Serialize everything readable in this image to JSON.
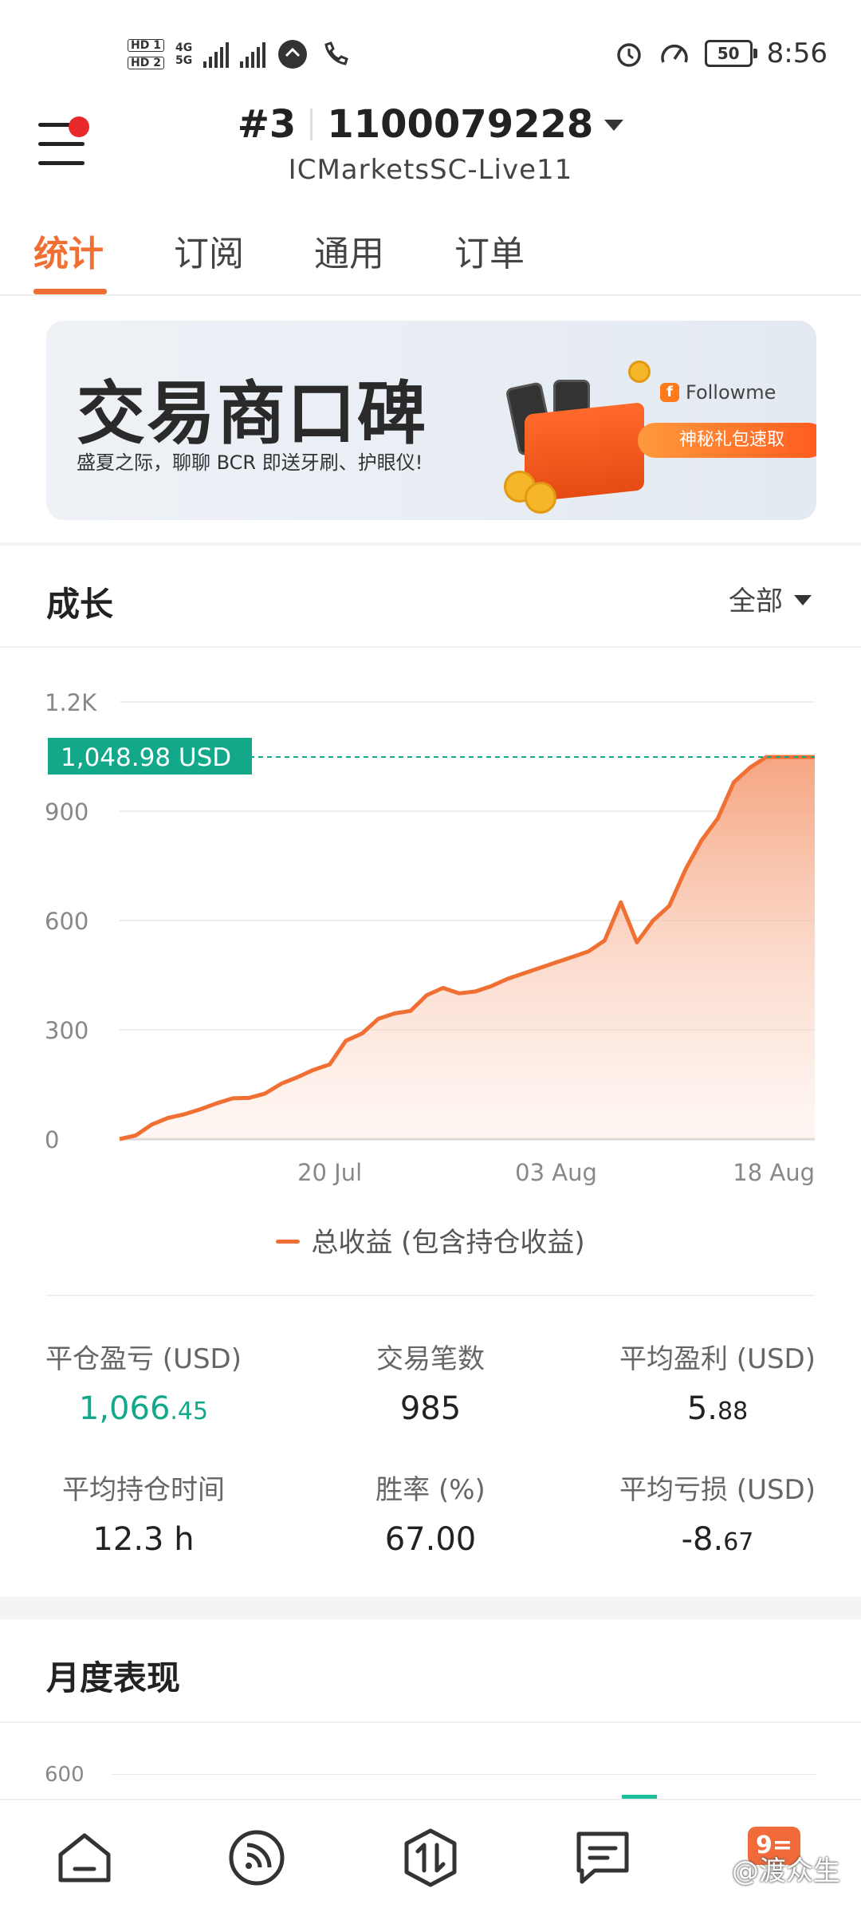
{
  "status_bar": {
    "hd1": "HD 1",
    "hd2": "HD 2",
    "net1": "4G",
    "net2": "5G",
    "battery": "50",
    "time": "8:56"
  },
  "header": {
    "account_index": "#3",
    "account_number": "1100079228",
    "server": "ICMarketsSC-Live11",
    "notification_color": "#e8292b"
  },
  "tabs": [
    {
      "label": "统计",
      "active": true
    },
    {
      "label": "订阅",
      "active": false
    },
    {
      "label": "通用",
      "active": false
    },
    {
      "label": "订单",
      "active": false
    }
  ],
  "accent_color": "#f07033",
  "banner": {
    "title": "交易商口碑",
    "subtitle": "盛夏之际，聊聊 BCR 即送牙刷、护眼仪!",
    "brand": "Followme",
    "cta": "神秘礼包速取"
  },
  "growth": {
    "title": "成长",
    "range": "全部"
  },
  "chart_data": {
    "type": "area",
    "series": [
      {
        "name": "总收益 (包含持仓收益)",
        "color": "#f07033",
        "x": [
          "2023-07-07",
          "2023-07-08",
          "2023-07-09",
          "2023-07-10",
          "2023-07-11",
          "2023-07-12",
          "2023-07-13",
          "2023-07-14",
          "2023-07-15",
          "2023-07-16",
          "2023-07-17",
          "2023-07-18",
          "2023-07-19",
          "2023-07-20",
          "2023-07-21",
          "2023-07-22",
          "2023-07-23",
          "2023-07-24",
          "2023-07-25",
          "2023-07-26",
          "2023-07-27",
          "2023-07-28",
          "2023-07-29",
          "2023-07-30",
          "2023-07-31",
          "2023-08-01",
          "2023-08-02",
          "2023-08-03",
          "2023-08-04",
          "2023-08-05",
          "2023-08-06",
          "2023-08-07",
          "2023-08-08",
          "2023-08-09",
          "2023-08-10",
          "2023-08-11",
          "2023-08-12",
          "2023-08-13",
          "2023-08-14",
          "2023-08-15",
          "2023-08-16",
          "2023-08-17",
          "2023-08-18",
          "2023-08-19"
        ],
        "values": [
          0,
          10,
          40,
          58,
          68,
          82,
          98,
          112,
          113,
          125,
          152,
          170,
          190,
          205,
          270,
          290,
          330,
          345,
          352,
          395,
          415,
          400,
          405,
          420,
          440,
          455,
          470,
          485,
          500,
          515,
          545,
          650,
          540,
          600,
          640,
          740,
          820,
          880,
          980,
          1020,
          1049,
          1049,
          1049,
          1049
        ]
      }
    ],
    "x_ticks": [
      "20 Jul",
      "03 Aug",
      "18 Aug"
    ],
    "y_ticks": [
      "0",
      "300",
      "600",
      "900",
      "1.2K"
    ],
    "ylim": [
      0,
      1200
    ],
    "current_value_label": "1,048.98 USD",
    "current_value": 1048.98,
    "grid": true,
    "legend_position": "bottom"
  },
  "stats": [
    {
      "label": "平仓盈亏 (USD)",
      "value_main": "1,066",
      "value_small": ".45",
      "color": "#13a88a"
    },
    {
      "label": "交易笔数",
      "value_main": "985",
      "value_small": ""
    },
    {
      "label": "平均盈利 (USD)",
      "value_main": "5.",
      "value_small": "88"
    },
    {
      "label": "平均持仓时间",
      "value_main": "12.3 h",
      "value_small": ""
    },
    {
      "label": "胜率 (%)",
      "value_main": "67.00",
      "value_small": ""
    },
    {
      "label": "平均亏损 (USD)",
      "value_main": "-8.",
      "value_small": "67"
    }
  ],
  "monthly": {
    "title": "月度表现",
    "y_tick": "600"
  },
  "bottom_nav": [
    {
      "icon": "home-icon"
    },
    {
      "icon": "feed-icon"
    },
    {
      "icon": "trade-icon"
    },
    {
      "icon": "messages-icon"
    },
    {
      "icon": "badge-icon",
      "label": "9="
    }
  ],
  "watermark": "@渡众生"
}
